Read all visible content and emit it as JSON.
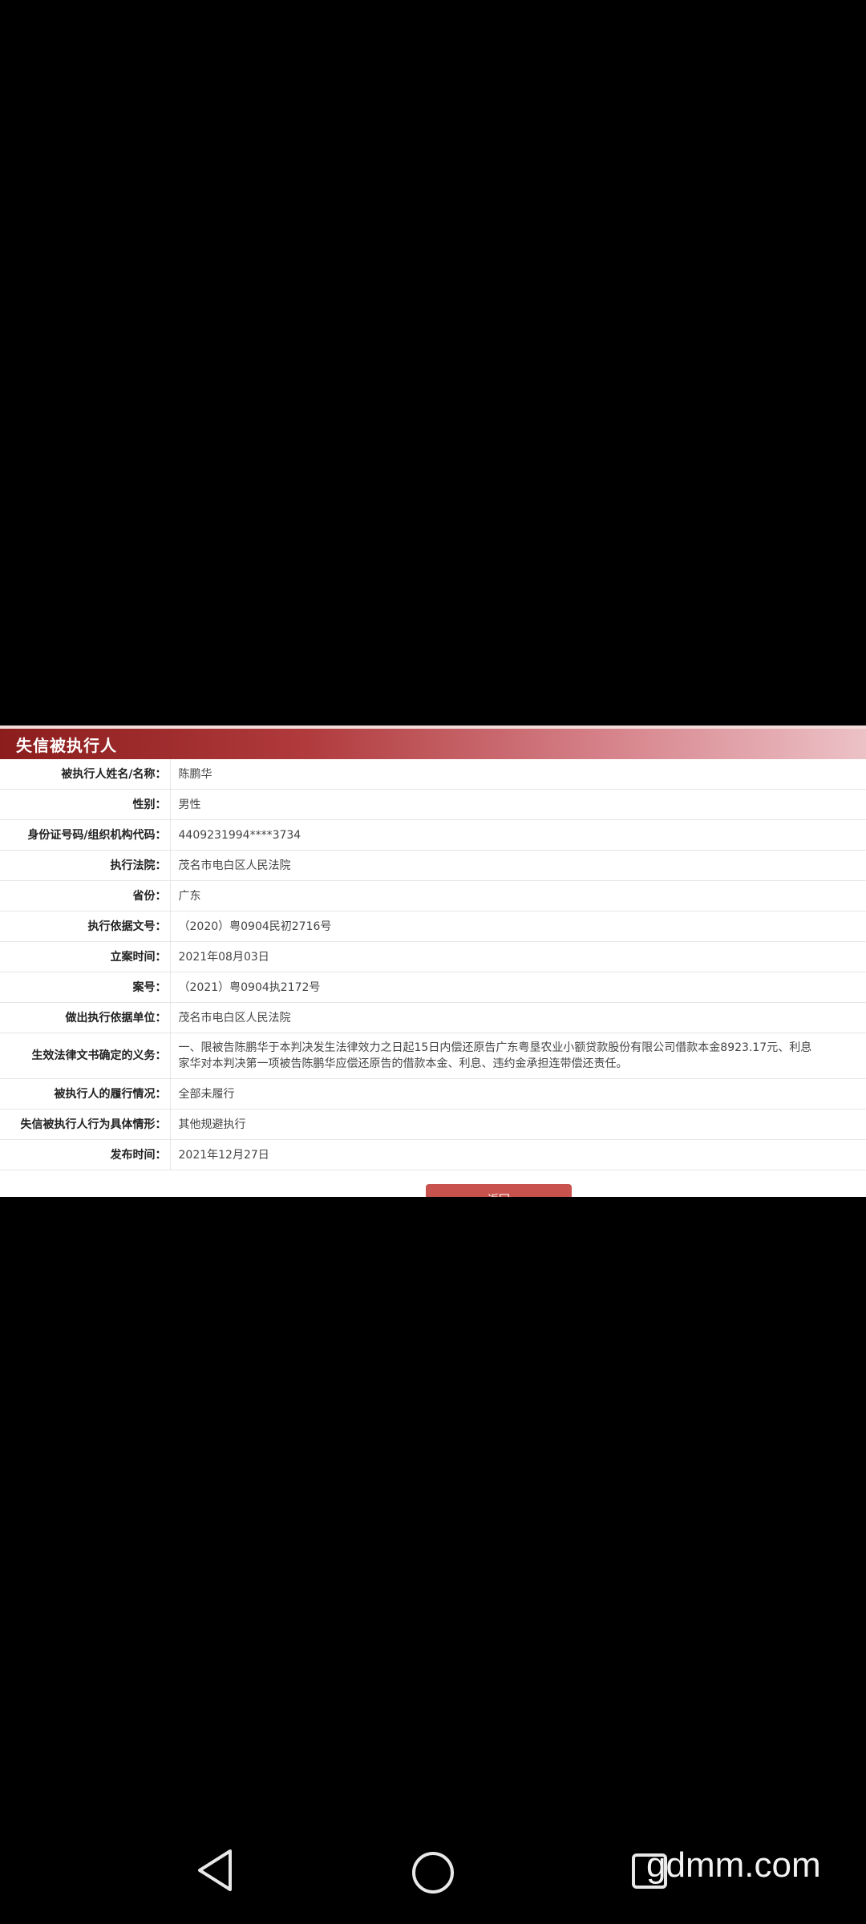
{
  "panel": {
    "title": "失信被执行人",
    "fields": [
      {
        "label": "被执行人姓名/名称：",
        "value": "陈鹏华"
      },
      {
        "label": "性别：",
        "value": "男性"
      },
      {
        "label": "身份证号码/组织机构代码：",
        "value": "4409231994****3734"
      },
      {
        "label": "执行法院：",
        "value": "茂名市电白区人民法院"
      },
      {
        "label": "省份：",
        "value": "广东"
      },
      {
        "label": "执行依据文号：",
        "value": "（2020）粤0904民初2716号"
      },
      {
        "label": "立案时间：",
        "value": "2021年08月03日"
      },
      {
        "label": "案号：",
        "value": "（2021）粤0904执2172号"
      },
      {
        "label": "做出执行依据单位：",
        "value": "茂名市电白区人民法院"
      },
      {
        "label": "生效法律文书确定的义务：",
        "value_line1": "一、限被告陈鹏华于本判决发生法律效力之日起15日内偿还原告广东粤垦农业小额贷款股份有限公司借款本金8923.17元、利息",
        "value_line2": "家华对本判决第一项被告陈鹏华应偿还原告的借款本金、利息、违约金承担连带偿还责任。"
      },
      {
        "label": "被执行人的履行情况：",
        "value": "全部未履行"
      },
      {
        "label": "失信被执行人行为具体情形：",
        "value": "其他规避执行"
      },
      {
        "label": "发布时间：",
        "value": "2021年12月27日"
      }
    ],
    "return_button": "返回"
  },
  "navbar": {
    "back_icon": "back-triangle-icon",
    "home_icon": "home-circle-icon",
    "recent_icon": "recent-square-icon"
  },
  "watermark": "gdmm.com"
}
